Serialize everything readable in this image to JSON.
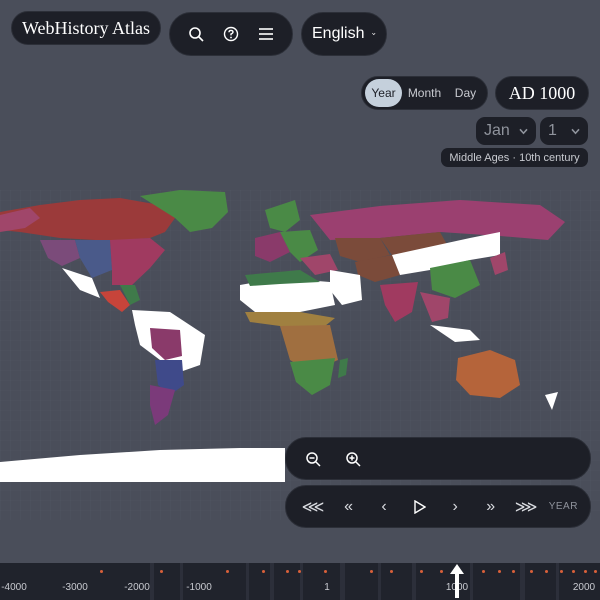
{
  "app": {
    "title": "WebHistory Atlas"
  },
  "toolbar": {
    "search_icon": "search-icon",
    "help_icon": "help-circle-icon",
    "menu_icon": "hamburger-menu-icon"
  },
  "language": {
    "selected": "English"
  },
  "granularity": {
    "options": [
      "Year",
      "Month",
      "Day"
    ],
    "selected": "Year"
  },
  "date": {
    "year_display": "AD 1000",
    "month": "Jan",
    "day": "1",
    "era": "Middle Ages · 10th century"
  },
  "playback": {
    "buttons": [
      "fast-rewind",
      "rewind",
      "step-back",
      "play",
      "step-forward",
      "forward",
      "fast-forward"
    ],
    "unit_label": "YEAR"
  },
  "timeline": {
    "labels": [
      "-4000",
      "-3000",
      "-2000",
      "-1000",
      "1",
      "1000",
      "2000"
    ],
    "current": "1000"
  },
  "colors": {
    "background": "#4a4e5a",
    "panel": "#1d1f27",
    "accent_active": "#c5d0dc",
    "event_dot": "#d9603a"
  }
}
